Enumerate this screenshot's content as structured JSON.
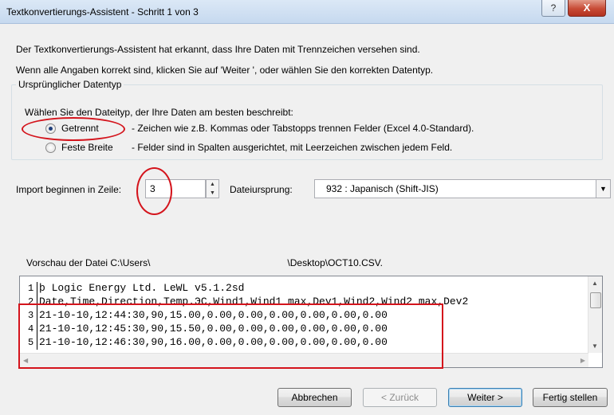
{
  "window": {
    "title": "Textkonvertierungs-Assistent - Schritt 1 von 3",
    "help_glyph": "?",
    "close_glyph": "X"
  },
  "intro": {
    "line1": "Der Textkonvertierungs-Assistent hat erkannt, dass Ihre Daten mit Trennzeichen versehen sind.",
    "line2": "Wenn alle Angaben korrekt sind, klicken Sie auf 'Weiter ', oder wählen Sie den korrekten Datentyp."
  },
  "datatype_group": {
    "legend": "Ursprünglicher Datentyp",
    "prompt": "Wählen Sie den Dateityp, der Ihre Daten am besten beschreibt:",
    "options": [
      {
        "label": "Getrennt",
        "description": "- Zeichen wie z.B. Kommas oder Tabstopps trennen Felder (Excel 4.0-Standard).",
        "checked": true
      },
      {
        "label": "Feste Breite",
        "description": "- Felder sind in Spalten ausgerichtet, mit Leerzeichen zwischen jedem Feld.",
        "checked": false
      }
    ]
  },
  "import": {
    "start_row_label": "Import beginnen in Zeile:",
    "start_row_value": "3",
    "origin_label": "Dateiursprung:",
    "origin_value": "932 : Japanisch (Shift-JIS)"
  },
  "preview": {
    "label_prefix": "Vorschau der Datei C:\\Users\\",
    "label_suffix": "\\Desktop\\OCT10.CSV.",
    "rows": [
      {
        "num": "1",
        "text": "þ Logic Energy Ltd. LeWL v5.1.2sd"
      },
      {
        "num": "2",
        "text": "Date,Time,Direction,Temp.ЭC,Wind1,Wind1 max,Dev1,Wind2,Wind2 max,Dev2"
      },
      {
        "num": "3",
        "text": "21-10-10,12:44:30,90,15.00,0.00,0.00,0.00,0.00,0.00,0.00"
      },
      {
        "num": "4",
        "text": "21-10-10,12:45:30,90,15.50,0.00,0.00,0.00,0.00,0.00,0.00"
      },
      {
        "num": "5",
        "text": "21-10-10,12:46:30,90,16.00,0.00,0.00,0.00,0.00,0.00,0.00"
      }
    ]
  },
  "buttons": {
    "cancel": "Abbrechen",
    "back": "< Zurück",
    "next": "Weiter >",
    "finish": "Fertig stellen"
  },
  "annotation_color": "#d4141c"
}
